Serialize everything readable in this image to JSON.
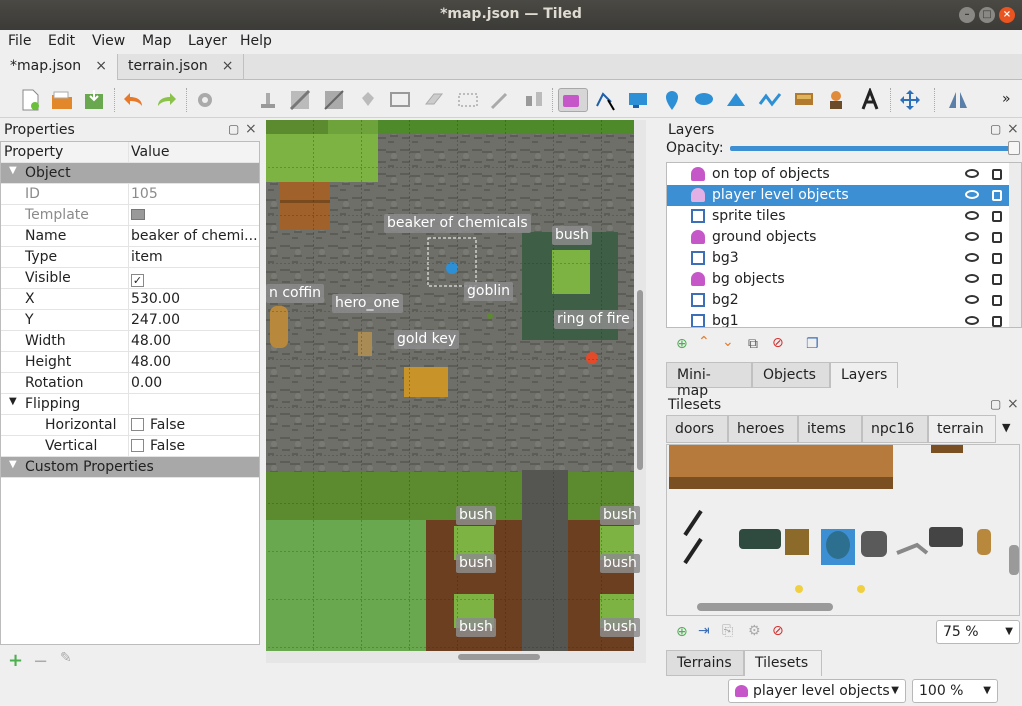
{
  "window": {
    "title": "*map.json — Tiled"
  },
  "menu": [
    "File",
    "Edit",
    "View",
    "Map",
    "Layer",
    "Help"
  ],
  "doc_tabs": [
    {
      "label": "*map.json",
      "close": "×"
    },
    {
      "label": "terrain.json",
      "close": "×"
    }
  ],
  "properties": {
    "title": "Properties",
    "col_property": "Property",
    "col_value": "Value",
    "group_object": "Object",
    "rows": [
      {
        "key": "ID",
        "value": "105"
      },
      {
        "key": "Template",
        "value": ""
      },
      {
        "key": "Name",
        "value": "beaker of chemi..."
      },
      {
        "key": "Type",
        "value": "item"
      },
      {
        "key": "Visible",
        "value": "✓"
      },
      {
        "key": "X",
        "value": "530.00"
      },
      {
        "key": "Y",
        "value": "247.00"
      },
      {
        "key": "Width",
        "value": "48.00"
      },
      {
        "key": "Height",
        "value": "48.00"
      },
      {
        "key": "Rotation",
        "value": "0.00"
      }
    ],
    "group_flipping": "Flipping",
    "flip_rows": [
      {
        "key": "Horizontal",
        "value": "False"
      },
      {
        "key": "Vertical",
        "value": "False"
      }
    ],
    "group_custom": "Custom Properties"
  },
  "map_labels": {
    "beaker": "beaker of chemicals",
    "bush1": "bush",
    "coffin": "n coffin",
    "hero": "hero_one",
    "goblin": "goblin",
    "ring": "ring of fire",
    "gold_key": "gold key",
    "bush2": "bush",
    "bush3": "bush",
    "bush4": "bush",
    "bush5": "bush",
    "bush6": "bush",
    "bush7": "bush"
  },
  "layers": {
    "title": "Layers",
    "opacity_label": "Opacity:",
    "items": [
      {
        "name": "on top of objects",
        "kind": "object"
      },
      {
        "name": "player level objects",
        "kind": "object",
        "selected": true
      },
      {
        "name": "sprite tiles",
        "kind": "tile"
      },
      {
        "name": "ground objects",
        "kind": "object"
      },
      {
        "name": "bg3",
        "kind": "tile"
      },
      {
        "name": "bg objects",
        "kind": "object"
      },
      {
        "name": "bg2",
        "kind": "tile"
      },
      {
        "name": "bg1",
        "kind": "tile"
      }
    ],
    "bottom_tabs": [
      "Mini-map",
      "Objects",
      "Layers"
    ]
  },
  "tilesets": {
    "title": "Tilesets",
    "tabs": [
      "doors",
      "heroes",
      "items",
      "npc16",
      "terrain"
    ],
    "zoom": "75 %",
    "bottom_tabs": [
      "Terrains",
      "Tilesets"
    ]
  },
  "status": {
    "layer_combo": "player level objects",
    "zoom_combo": "100 %"
  },
  "colors": {
    "selection": "#3d8fd3",
    "titlebar": "#3c3b37",
    "grass": "#5f9e34",
    "stone": "#707070"
  }
}
